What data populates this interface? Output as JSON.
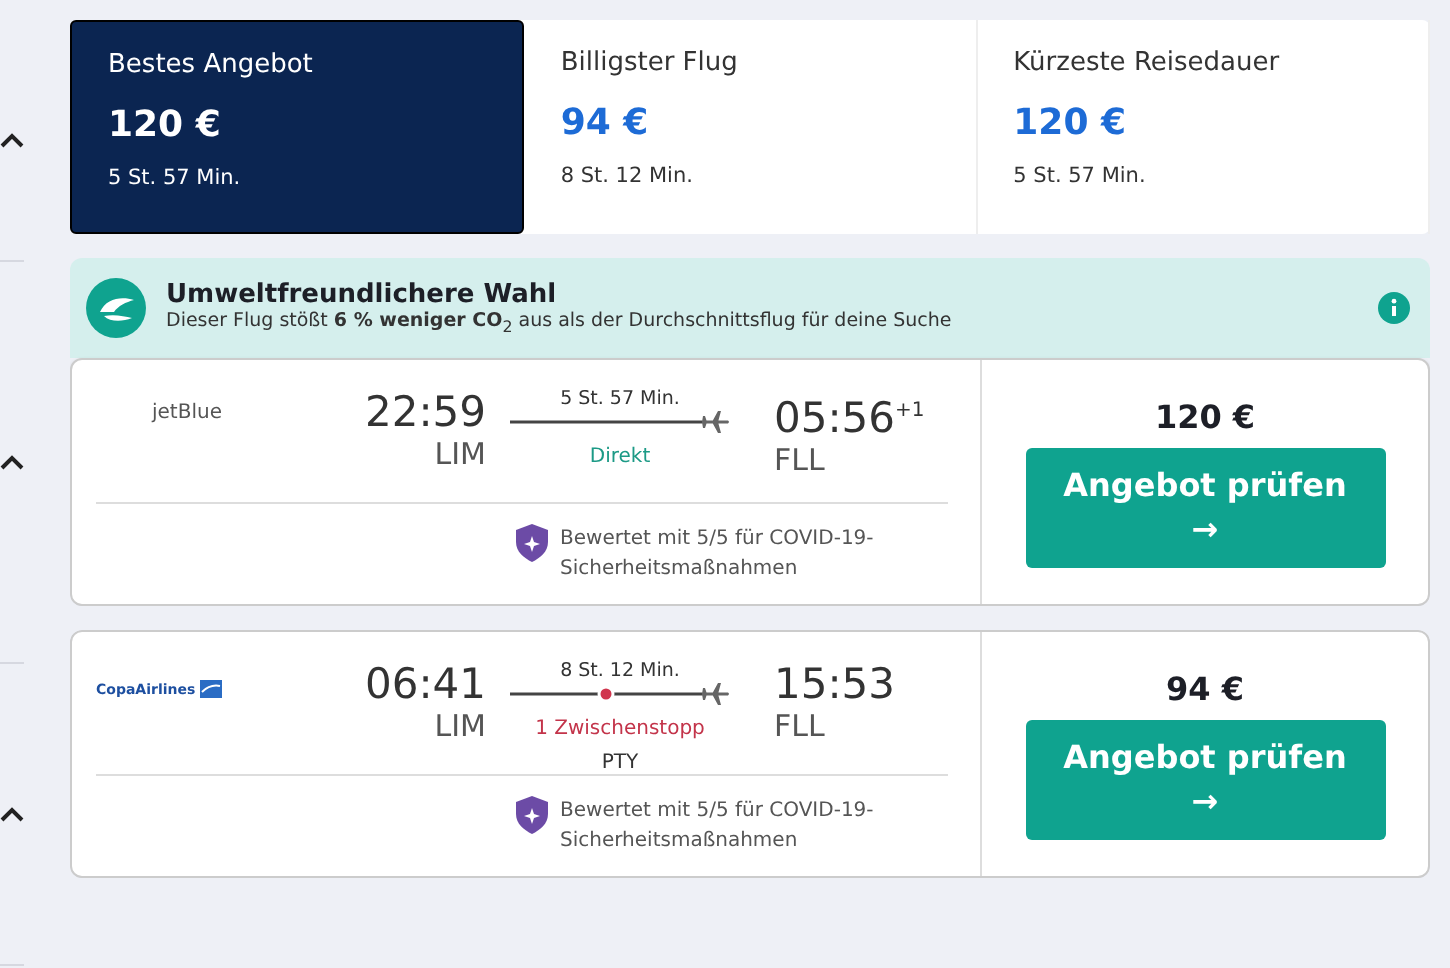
{
  "sort_tabs": [
    {
      "label": "Bestes Angebot",
      "price": "120 €",
      "duration": "5 St. 57 Min.",
      "selected": true
    },
    {
      "label": "Billigster Flug",
      "price": "94 €",
      "duration": "8 St. 12 Min.",
      "selected": false
    },
    {
      "label": "Kürzeste Reisedauer",
      "price": "120 €",
      "duration": "5 St. 57 Min.",
      "selected": false
    }
  ],
  "eco_banner": {
    "title": "Umweltfreundlichere Wahl",
    "text": "Dieser Flug stößt **6 % weniger CO**$_{2}$ aus als der Durchschnittsflug für deine Suche"
  },
  "flights": [
    {
      "airline": {
        "name": "jetBlue",
        "kind": "text"
      },
      "departure_time": "22:59",
      "departure_airport": "LIM",
      "duration": "5 St. 57 Min.",
      "stops": {
        "kind": "direct"
      },
      "stops_label": "Direkt",
      "arrival_time": "05:56",
      "day_offset": "+1",
      "arrival_airport": "FLL",
      "rating": "Bewertet mit 5/5 für COVID-19-Sicherheitsmaßnahmen",
      "price": "120 €",
      "button": "Angebot prüfen",
      "button_arrow": "→"
    },
    {
      "airline": {
        "name": "CopaAirlines",
        "kind": "logo"
      },
      "departure_time": "06:41",
      "departure_airport": "LIM",
      "duration": "8 St. 12 Min.",
      "stops": {
        "kind": "stop"
      },
      "stops_label": "1 Zwischenstopp",
      "via": "PTY",
      "arrival_time": "15:53",
      "arrival_airport": "FLL",
      "rating": "Bewertet mit 5/5 für COVID-19-Sicherheitsmaßnahmen",
      "price": "94 €",
      "button": "Angebot prüfen",
      "button_arrow": "→"
    }
  ]
}
